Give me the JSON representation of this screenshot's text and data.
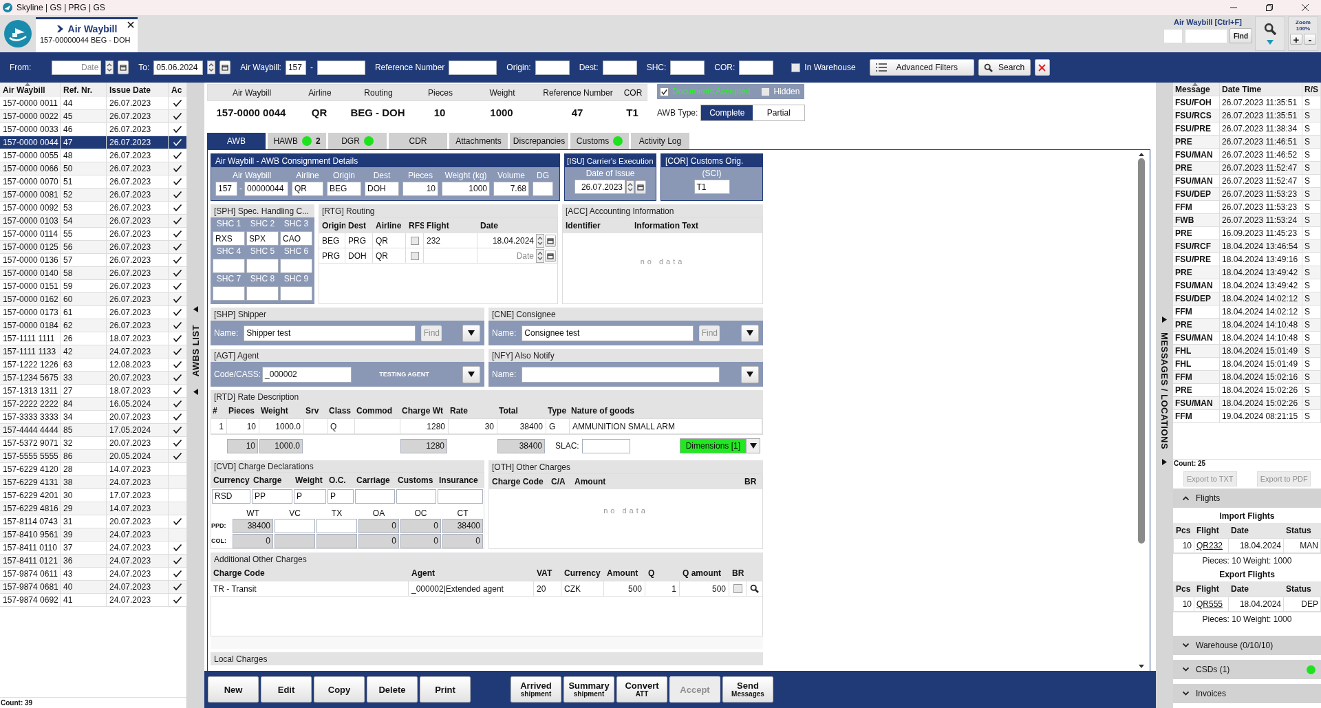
{
  "window": {
    "title": "Skyline | GS | PRG | GS"
  },
  "document_tab": {
    "title": "Air Waybill",
    "subtitle": "157-00000044 BEG - DOH",
    "selected": true
  },
  "quick_find": {
    "label": "Air Waybill [Ctrl+F]",
    "button": "Find",
    "zoom_label": "Zoom",
    "zoom_value": "100%",
    "zoom_in": "+",
    "zoom_out": "-"
  },
  "filters": {
    "from": {
      "label": "From:",
      "placeholder": "Date"
    },
    "to": {
      "label": "To:",
      "value": "05.06.2024"
    },
    "awb": {
      "label": "Air Waybill:",
      "prefix": "157",
      "separator": "-"
    },
    "text_fields": [
      {
        "label": "Reference Number"
      },
      {
        "label": "Origin:"
      },
      {
        "label": "Dest:"
      },
      {
        "label": "SHC:"
      },
      {
        "label": "COR:"
      }
    ],
    "in_warehouse": {
      "label": "In Warehouse",
      "checked": false
    },
    "advanced": "Advanced Filters",
    "search": "Search"
  },
  "awb_list": {
    "side_label": "AWBS LIST",
    "columns": [
      "Air Waybill",
      "Ref. Nr.",
      "Issue Date",
      "Ac"
    ],
    "count": "Count: 39",
    "rows": [
      {
        "awb": "157-0000 0011",
        "ref": "44",
        "date": "26.07.2023",
        "accepted": true,
        "selected": false
      },
      {
        "awb": "157-0000 0022",
        "ref": "45",
        "date": "26.07.2023",
        "accepted": true,
        "selected": false
      },
      {
        "awb": "157-0000 0033",
        "ref": "46",
        "date": "26.07.2023",
        "accepted": true,
        "selected": false
      },
      {
        "awb": "157-0000 0044",
        "ref": "47",
        "date": "26.07.2023",
        "accepted": true,
        "selected": true
      },
      {
        "awb": "157-0000 0055",
        "ref": "48",
        "date": "26.07.2023",
        "accepted": true,
        "selected": false
      },
      {
        "awb": "157-0000 0066",
        "ref": "50",
        "date": "26.07.2023",
        "accepted": true,
        "selected": false
      },
      {
        "awb": "157-0000 0070",
        "ref": "51",
        "date": "26.07.2023",
        "accepted": true,
        "selected": false
      },
      {
        "awb": "157-0000 0081",
        "ref": "52",
        "date": "26.07.2023",
        "accepted": true,
        "selected": false
      },
      {
        "awb": "157-0000 0092",
        "ref": "53",
        "date": "26.07.2023",
        "accepted": true,
        "selected": false
      },
      {
        "awb": "157-0000 0103",
        "ref": "54",
        "date": "26.07.2023",
        "accepted": true,
        "selected": false
      },
      {
        "awb": "157-0000 0114",
        "ref": "55",
        "date": "26.07.2023",
        "accepted": true,
        "selected": false
      },
      {
        "awb": "157-0000 0125",
        "ref": "56",
        "date": "26.07.2023",
        "accepted": true,
        "selected": false
      },
      {
        "awb": "157-0000 0136",
        "ref": "57",
        "date": "26.07.2023",
        "accepted": true,
        "selected": false
      },
      {
        "awb": "157-0000 0140",
        "ref": "58",
        "date": "26.07.2023",
        "accepted": true,
        "selected": false
      },
      {
        "awb": "157-0000 0151",
        "ref": "59",
        "date": "26.07.2023",
        "accepted": true,
        "selected": false
      },
      {
        "awb": "157-0000 0162",
        "ref": "60",
        "date": "26.07.2023",
        "accepted": true,
        "selected": false
      },
      {
        "awb": "157-0000 0173",
        "ref": "61",
        "date": "26.07.2023",
        "accepted": true,
        "selected": false
      },
      {
        "awb": "157-0000 0184",
        "ref": "62",
        "date": "26.07.2023",
        "accepted": true,
        "selected": false
      },
      {
        "awb": "157-1111 1111",
        "ref": "26",
        "date": "18.07.2023",
        "accepted": true,
        "selected": false
      },
      {
        "awb": "157-1111 1133",
        "ref": "42",
        "date": "24.07.2023",
        "accepted": true,
        "selected": false
      },
      {
        "awb": "157-1222 1226",
        "ref": "63",
        "date": "12.08.2023",
        "accepted": true,
        "selected": false
      },
      {
        "awb": "157-1234 5675",
        "ref": "33",
        "date": "20.07.2023",
        "accepted": true,
        "selected": false
      },
      {
        "awb": "157-1313 1311",
        "ref": "27",
        "date": "18.07.2023",
        "accepted": true,
        "selected": false
      },
      {
        "awb": "157-2222 2222",
        "ref": "84",
        "date": "16.05.2024",
        "accepted": true,
        "selected": false
      },
      {
        "awb": "157-3333 3333",
        "ref": "34",
        "date": "20.07.2023",
        "accepted": true,
        "selected": false
      },
      {
        "awb": "157-4444 4444",
        "ref": "85",
        "date": "17.05.2024",
        "accepted": true,
        "selected": false
      },
      {
        "awb": "157-5372 9071",
        "ref": "32",
        "date": "20.07.2023",
        "accepted": true,
        "selected": false
      },
      {
        "awb": "157-5555 5555",
        "ref": "86",
        "date": "20.05.2024",
        "accepted": true,
        "selected": false
      },
      {
        "awb": "157-6229 4120",
        "ref": "28",
        "date": "14.07.2023",
        "accepted": false,
        "selected": false
      },
      {
        "awb": "157-6229 4131",
        "ref": "38",
        "date": "24.07.2023",
        "accepted": false,
        "selected": false
      },
      {
        "awb": "157-6229 4201",
        "ref": "30",
        "date": "17.07.2023",
        "accepted": false,
        "selected": false
      },
      {
        "awb": "157-6229 4816",
        "ref": "29",
        "date": "14.07.2023",
        "accepted": false,
        "selected": false
      },
      {
        "awb": "157-8114 0743",
        "ref": "31",
        "date": "20.07.2023",
        "accepted": true,
        "selected": false
      },
      {
        "awb": "157-8410 9561",
        "ref": "39",
        "date": "24.07.2023",
        "accepted": false,
        "selected": false
      },
      {
        "awb": "157-8411 0110",
        "ref": "37",
        "date": "24.07.2023",
        "accepted": true,
        "selected": false
      },
      {
        "awb": "157-8411 0121",
        "ref": "36",
        "date": "24.07.2023",
        "accepted": true,
        "selected": false
      },
      {
        "awb": "157-9874 0611",
        "ref": "43",
        "date": "24.07.2023",
        "accepted": true,
        "selected": false
      },
      {
        "awb": "157-9874 0681",
        "ref": "40",
        "date": "24.07.2023",
        "accepted": true,
        "selected": false
      },
      {
        "awb": "157-9874 0692",
        "ref": "41",
        "date": "24.07.2023",
        "accepted": true,
        "selected": false
      }
    ]
  },
  "summary": {
    "columns": [
      "Air Waybill",
      "Airline",
      "Routing",
      "Pieces",
      "Weight",
      "Reference Number",
      "COR"
    ],
    "values": [
      "157-0000 0044",
      "QR",
      "BEG - DOH",
      "10",
      "1000",
      "47",
      "T1"
    ],
    "documents_accepted": {
      "label": "Documents Accepted",
      "checked": true
    },
    "hidden": {
      "label": "Hidden",
      "checked": false
    },
    "awb_type": {
      "label": "AWB Type:",
      "options": [
        {
          "label": "Complete",
          "selected": true
        },
        {
          "label": "Partial",
          "selected": false
        }
      ]
    }
  },
  "tabs": [
    {
      "label": "AWB",
      "selected": true,
      "status_dot": false
    },
    {
      "label": "HAWB",
      "selected": false,
      "status_dot": true,
      "count": "2"
    },
    {
      "label": "DGR",
      "selected": false,
      "status_dot": true
    },
    {
      "label": "CDR",
      "selected": false,
      "status_dot": false
    },
    {
      "label": "Attachments",
      "selected": false,
      "status_dot": false
    },
    {
      "label": "Discrepancies",
      "selected": false,
      "status_dot": false
    },
    {
      "label": "Customs",
      "selected": false,
      "status_dot": true
    },
    {
      "label": "Activity Log",
      "selected": false,
      "status_dot": false
    }
  ],
  "consignment": {
    "title": "Air Waybill - AWB Consignment Details",
    "fields": [
      {
        "label": "Air Waybill",
        "prefix": "157",
        "separator": "-",
        "value": "00000044"
      },
      {
        "label": "Airline",
        "value": "QR"
      },
      {
        "label": "Origin",
        "value": "BEG"
      },
      {
        "label": "Dest",
        "value": "DOH"
      },
      {
        "label": "Pieces",
        "value": "10",
        "numeric": true
      },
      {
        "label": "Weight (kg)",
        "value": "1000",
        "numeric": true
      },
      {
        "label": "Volume",
        "value": "7.68",
        "numeric": true
      },
      {
        "label": "DG"
      }
    ]
  },
  "carrier_execution": {
    "title": "[ISU] Carrier's Execution",
    "label": "Date of Issue",
    "value": "26.07.2023"
  },
  "customs_origin": {
    "title": "[COR] Customs Orig.",
    "label": "(SCI)",
    "value": "T1"
  },
  "special_handling": {
    "title": "[SPH] Spec. Handling C...",
    "codes": [
      {
        "label": "SHC 1",
        "value": "RXS"
      },
      {
        "label": "SHC 2",
        "value": "SPX"
      },
      {
        "label": "SHC 3",
        "value": "CAO"
      },
      {
        "label": "SHC 4"
      },
      {
        "label": "SHC 5"
      },
      {
        "label": "SHC 6"
      },
      {
        "label": "SHC 7"
      },
      {
        "label": "SHC 8"
      },
      {
        "label": "SHC 9"
      }
    ]
  },
  "routing": {
    "title": "[RTG] Routing",
    "columns": [
      "Origin",
      "Dest",
      "Airline",
      "RFS",
      "Flight",
      "Date"
    ],
    "rows": [
      {
        "origin": "BEG",
        "dest": "PRG",
        "airline": "QR",
        "rfs": false,
        "flight": "232",
        "date": "18.04.2024"
      },
      {
        "origin": "PRG",
        "dest": "DOH",
        "airline": "QR",
        "rfs": false,
        "date_placeholder": "Date"
      }
    ]
  },
  "accounting": {
    "title": "[ACC] Accounting Information",
    "columns": [
      "Identifier",
      "Information Text"
    ],
    "empty": "no data"
  },
  "shipper": {
    "title": "[SHP] Shipper",
    "label": "Name:",
    "value": "Shipper test",
    "find": "Find"
  },
  "consignee": {
    "title": "[CNE] Consignee",
    "label": "Name:",
    "value": "Consignee test",
    "find": "Find"
  },
  "agent": {
    "title": "[AGT] Agent",
    "label": "Code/CASS:",
    "value": "_000002",
    "name": "TESTING AGENT"
  },
  "notify": {
    "title": "[NFY] Also Notify",
    "label": "Name:"
  },
  "rates": {
    "title": "[RTD] Rate Description",
    "columns": [
      "#",
      "Pieces",
      "Weight",
      "Srv",
      "Class",
      "Commod",
      "Charge Wt",
      "Rate",
      "Total",
      "Type",
      "Nature of goods"
    ],
    "rows": [
      {
        "index": "1",
        "pieces": "10",
        "weight": "1000.0",
        "class": "Q",
        "charge_wt": "1280",
        "rate": "30",
        "total": "38400",
        "type": "G",
        "goods": "AMMUNITION SMALL ARM"
      }
    ],
    "totals": {
      "pieces": "10",
      "weight": "1000.0",
      "charge_wt": "1280",
      "total": "38400"
    },
    "slac": "SLAC:",
    "dimensions": "Dimensions [1]"
  },
  "charge_declarations": {
    "title": "[CVD] Charge Declarations",
    "columns": [
      "Currency",
      "Charge",
      "Weight",
      "O.C.",
      "Carriage",
      "Customs",
      "Insurance"
    ],
    "values": [
      "RSD",
      "PP",
      "P",
      "P"
    ],
    "summary_columns": [
      "WT",
      "VC",
      "TX",
      "OA",
      "OC",
      "CT"
    ],
    "summary_rows": [
      {
        "label": "PPD:",
        "cells": [
          {
            "kind": "readonly",
            "value": "38400"
          },
          {
            "kind": "input"
          },
          {
            "kind": "input"
          },
          {
            "kind": "readonly",
            "value": "0"
          },
          {
            "kind": "readonly",
            "value": "0"
          },
          {
            "kind": "readonly",
            "value": "38400"
          }
        ]
      },
      {
        "label": "COL:",
        "cells": [
          {
            "kind": "readonly",
            "value": "0"
          },
          {
            "kind": "readonly"
          },
          {
            "kind": "readonly"
          },
          {
            "kind": "readonly",
            "value": "0"
          },
          {
            "kind": "readonly",
            "value": "0"
          },
          {
            "kind": "readonly",
            "value": "0"
          }
        ]
      }
    ]
  },
  "other_charges": {
    "title": "[OTH] Other Charges",
    "columns": [
      "Charge Code",
      "C/A",
      "Amount",
      "BR"
    ],
    "empty": "no data"
  },
  "additional_charges": {
    "title": "Additional Other Charges",
    "columns": [
      "Charge Code",
      "Agent",
      "VAT",
      "Currency",
      "Amount",
      "Q",
      "Q amount",
      "BR"
    ],
    "rows": [
      {
        "charge_code": "TR - Transit",
        "agent": "_000002|Extended agent",
        "vat": "20",
        "currency": "CZK",
        "amount": "500",
        "q": "1",
        "q_amount": "500",
        "br": false
      }
    ]
  },
  "local_charges": {
    "title": "Local Charges"
  },
  "buttons": {
    "main": [
      {
        "label": "New",
        "disabled": false
      },
      {
        "label": "Edit",
        "disabled": false
      },
      {
        "label": "Copy",
        "disabled": false
      },
      {
        "label": "Delete",
        "disabled": false
      },
      {
        "label": "Print",
        "disabled": false
      }
    ],
    "process": [
      {
        "label": "Arrived",
        "sub": "shipment",
        "disabled": false
      },
      {
        "label": "Summary",
        "sub": "shipment",
        "disabled": false
      },
      {
        "label": "Convert",
        "sub": "ATT",
        "disabled": false
      },
      {
        "label": "Accept",
        "disabled": true
      },
      {
        "label": "Send",
        "sub": "Messages",
        "disabled": false
      }
    ]
  },
  "messages": {
    "side_label": "MESSAGES / LOCATIONS",
    "columns": [
      "Message",
      "Date Time",
      "R/S"
    ],
    "count": "Count: 25",
    "exports": [
      {
        "label": "Export to TXT",
        "disabled": true
      },
      {
        "label": "Export to PDF",
        "disabled": true
      }
    ],
    "rows": [
      {
        "message": "FSU/FOH",
        "time": "26.07.2023 11:35:51",
        "rs": "S"
      },
      {
        "message": "FSU/RCS",
        "time": "26.07.2023 11:35:51",
        "rs": "S"
      },
      {
        "message": "FSU/PRE",
        "time": "26.07.2023 11:38:34",
        "rs": "S"
      },
      {
        "message": "PRE",
        "time": "26.07.2023 11:46:51",
        "rs": "S"
      },
      {
        "message": "FSU/MAN",
        "time": "26.07.2023 11:46:52",
        "rs": "S"
      },
      {
        "message": "PRE",
        "time": "26.07.2023 11:52:47",
        "rs": "S"
      },
      {
        "message": "FSU/MAN",
        "time": "26.07.2023 11:52:47",
        "rs": "S"
      },
      {
        "message": "FSU/DEP",
        "time": "26.07.2023 11:53:23",
        "rs": "S"
      },
      {
        "message": "FFM",
        "time": "26.07.2023 11:53:23",
        "rs": "S"
      },
      {
        "message": "FWB",
        "time": "26.07.2023 11:53:24",
        "rs": "S"
      },
      {
        "message": "PRE",
        "time": "16.09.2023 11:45:23",
        "rs": "S"
      },
      {
        "message": "FSU/RCF",
        "time": "18.04.2024 13:46:54",
        "rs": "S"
      },
      {
        "message": "FSU/PRE",
        "time": "18.04.2024 13:49:16",
        "rs": "S"
      },
      {
        "message": "PRE",
        "time": "18.04.2024 13:49:42",
        "rs": "S"
      },
      {
        "message": "FSU/MAN",
        "time": "18.04.2024 13:49:42",
        "rs": "S"
      },
      {
        "message": "FSU/DEP",
        "time": "18.04.2024 14:02:12",
        "rs": "S"
      },
      {
        "message": "FFM",
        "time": "18.04.2024 14:02:12",
        "rs": "S"
      },
      {
        "message": "PRE",
        "time": "18.04.2024 14:10:48",
        "rs": "S"
      },
      {
        "message": "FSU/MAN",
        "time": "18.04.2024 14:10:48",
        "rs": "S"
      },
      {
        "message": "FHL",
        "time": "18.04.2024 15:01:49",
        "rs": "S"
      },
      {
        "message": "FHL",
        "time": "18.04.2024 15:01:49",
        "rs": "S"
      },
      {
        "message": "FFM",
        "time": "18.04.2024 15:02:16",
        "rs": "S"
      },
      {
        "message": "PRE",
        "time": "18.04.2024 15:02:26",
        "rs": "S"
      },
      {
        "message": "FSU/MAN",
        "time": "18.04.2024 15:02:26",
        "rs": "S"
      },
      {
        "message": "FFM",
        "time": "19.04.2024 08:21:15",
        "rs": "S"
      }
    ]
  },
  "sections": [
    {
      "title": "Flights",
      "expanded": true,
      "status_dot": false,
      "groups": [
        {
          "title": "Import Flights",
          "columns": [
            "Pcs",
            "Flight",
            "Date",
            "Status"
          ],
          "rows": [
            {
              "pcs": "10",
              "flight": "QR232",
              "date": "18.04.2024",
              "status": "MAN"
            }
          ],
          "summary": "Pieces: 10 Weight: 1000"
        },
        {
          "title": "Export Flights",
          "columns": [
            "Pcs",
            "Flight",
            "Date",
            "Status"
          ],
          "rows": [
            {
              "pcs": "10",
              "flight": "QR555",
              "date": "18.04.2024",
              "status": "DEP"
            }
          ],
          "summary": "Pieces: 10 Weight: 1000"
        }
      ]
    },
    {
      "title": "Warehouse (0/10/10)",
      "expanded": false,
      "status_dot": false
    },
    {
      "title": "CSDs (1)",
      "expanded": false,
      "status_dot": true
    },
    {
      "title": "Invoices",
      "expanded": false,
      "status_dot": false
    }
  ]
}
